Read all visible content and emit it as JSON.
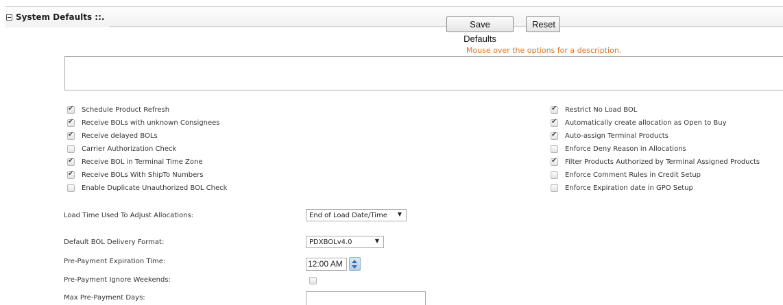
{
  "section": {
    "title": "System Defaults ::."
  },
  "toolbar": {
    "save_label": "Save Defaults",
    "reset_label": "Reset"
  },
  "hint": "Mouse over the options for a description.",
  "description": "",
  "options_left": [
    {
      "label": "Schedule Product Refresh",
      "checked": true
    },
    {
      "label": "Receive BOLs with unknown Consignees",
      "checked": true
    },
    {
      "label": "Receive delayed BOLs",
      "checked": true
    },
    {
      "label": "Carrier Authorization Check",
      "checked": false
    },
    {
      "label": "Receive BOL in Terminal Time Zone",
      "checked": true
    },
    {
      "label": "Receive BOLs With ShipTo Numbers",
      "checked": true
    },
    {
      "label": "Enable Duplicate Unauthorized BOL Check",
      "checked": false
    }
  ],
  "options_right": [
    {
      "label": "Restrict No Load BOL",
      "checked": true
    },
    {
      "label": "Automatically create allocation as Open to Buy",
      "checked": true
    },
    {
      "label": "Auto-assign Terminal Products",
      "checked": true
    },
    {
      "label": "Enforce Deny Reason in Allocations",
      "checked": false
    },
    {
      "label": "Filter Products Authorized by Terminal Assigned Products",
      "checked": true
    },
    {
      "label": "Enforce Comment Rules in Credit Setup",
      "checked": false
    },
    {
      "label": "Enforce Expiration date in GPO Setup",
      "checked": false
    }
  ],
  "fields": {
    "load_time": {
      "label": "Load Time Used To Adjust Allocations:",
      "value": "End of Load Date/Time"
    },
    "bol_format": {
      "label": "Default BOL Delivery Format:",
      "value": "PDXBOLv4.0"
    },
    "prepay_expiration": {
      "label": "Pre-Payment Expiration Time:",
      "value": "12:00 AM"
    },
    "prepay_weekends": {
      "label": "Pre-Payment Ignore Weekends:",
      "checked": false
    },
    "max_prepay_days": {
      "label": "Max Pre-Payment Days:",
      "value": ""
    }
  }
}
